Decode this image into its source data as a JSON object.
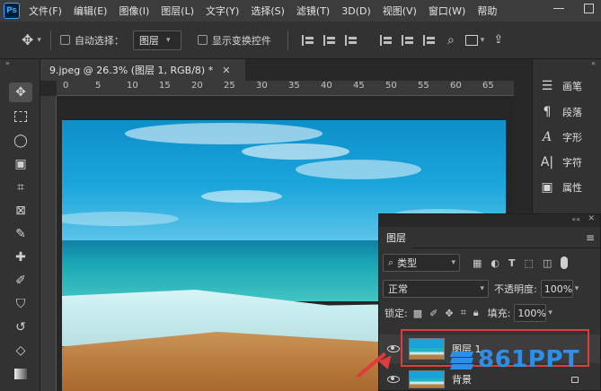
{
  "app": {
    "logo": "Ps"
  },
  "menu": [
    "文件(F)",
    "编辑(E)",
    "图像(I)",
    "图层(L)",
    "文字(Y)",
    "选择(S)",
    "滤镜(T)",
    "3D(D)",
    "视图(V)",
    "窗口(W)",
    "帮助"
  ],
  "options": {
    "auto_select_label": "自动选择：",
    "layer_select_value": "图层",
    "show_transform_label": "显示变换控件"
  },
  "document": {
    "tab_title": "9.jpeg @ 26.3% (图层 1, RGB/8) *",
    "ruler_ticks": [
      "0",
      "5",
      "10",
      "15",
      "20",
      "25",
      "30",
      "35",
      "40",
      "45",
      "50",
      "55",
      "60",
      "65"
    ]
  },
  "right_panels": [
    {
      "label": "画笔",
      "icon": "brush-settings-icon"
    },
    {
      "label": "段落",
      "icon": "paragraph-icon"
    },
    {
      "label": "字形",
      "icon": "glyphs-icon"
    },
    {
      "label": "字符",
      "icon": "character-icon"
    },
    {
      "label": "属性",
      "icon": "properties-icon"
    }
  ],
  "layers_panel": {
    "tab_label": "图层",
    "filter_value": "类型",
    "blend_mode": "正常",
    "opacity_label": "不透明度:",
    "opacity_value": "100%",
    "lock_label": "锁定:",
    "fill_label": "填充:",
    "fill_value": "100%",
    "layers": [
      {
        "name": "图层 1",
        "selected": true
      },
      {
        "name": "背景",
        "locked": true
      }
    ]
  },
  "watermark": {
    "text": "861PPT"
  },
  "colors": {
    "highlight": "#e03c3c",
    "watermark": "#2f8fe8",
    "ui_dark": "#323232"
  }
}
